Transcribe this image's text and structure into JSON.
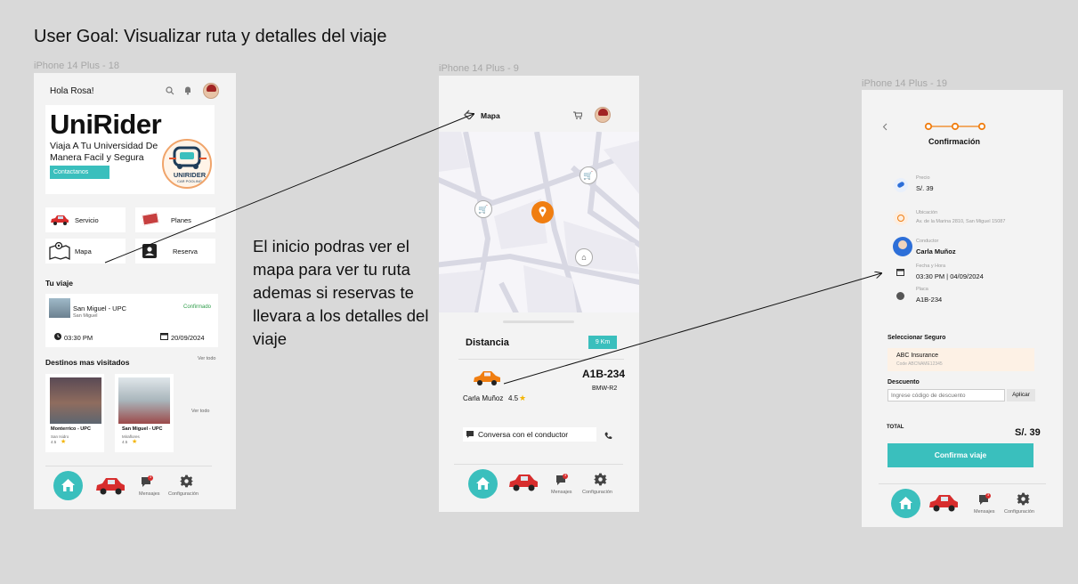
{
  "goal": "User Goal: Visualizar ruta y detalles del viaje",
  "annotation": "El inicio podras ver el mapa para ver tu ruta ademas si reservas te llevara a los detalles del viaje",
  "colors": {
    "accent": "#3abfbd",
    "orange": "#f07e11",
    "red": "#d72d2d",
    "canvas": "#d9d9d9"
  },
  "frame1": {
    "label": "iPhone 14 Plus - 18",
    "greeting": "Hola Rosa!",
    "brand": "UniRider",
    "tagline": "Viaja A Tu Universidad De Manera Facil y Segura",
    "contact_button": "Contactanos",
    "logo_text": "UNIRIDER",
    "logo_sub": "CAR POOLING",
    "tiles": {
      "servicio": "Servicio",
      "planes": "Planes",
      "mapa": "Mapa",
      "reserva": "Reserva"
    },
    "your_trip_title": "Tu viaje",
    "trip": {
      "route": "San Miguel - UPC",
      "district": "San Miguel",
      "status": "Confirmado",
      "time": "03:30 PM",
      "date": "20/09/2024"
    },
    "popular_title": "Destinos mas visitados",
    "see_all": "Ver todo",
    "see_all_2": "Ver todo",
    "destinations": [
      {
        "name": "Monterrico - UPC",
        "area": "San Isidro",
        "rating": "4.5"
      },
      {
        "name": "San Miguel - UPC",
        "area": "Miraflores",
        "rating": "4.5"
      }
    ],
    "nav": {
      "messages": "Mensajes",
      "settings": "Configuración",
      "badge": "3"
    }
  },
  "frame2": {
    "label": "iPhone 14 Plus - 9",
    "title": "Mapa",
    "distance_label": "Distancia",
    "distance_value": "9 Km",
    "plate": "A1B-234",
    "model": "BMW-R2",
    "driver": "Carla Muñoz",
    "rating": "4.5",
    "chat": "Conversa con el conductor",
    "nav": {
      "messages": "Mensajes",
      "settings": "Configuración",
      "badge": "3"
    }
  },
  "frame3": {
    "label": "iPhone 14 Plus - 19",
    "title": "Confirmación",
    "price_label": "Precio",
    "price": "S/. 39",
    "location_label": "Ubicación",
    "location": "Av. de la Marina 2810, San Miguel 15087",
    "driver_label": "Conductor",
    "driver": "Carla Muñoz",
    "datetime_label": "Fecha y Hora",
    "datetime": "03:30 PM | 04/09/2024",
    "plate_label": "Placa",
    "plate": "A1B-234",
    "insurance_title": "Seleccionar Seguro",
    "insurance_name": "ABC Insurance",
    "insurance_code": "Code ABCNAME12345",
    "discount_title": "Descuento",
    "discount_placeholder": "Ingrese código de descuento",
    "apply": "Aplicar",
    "total_label": "TOTAL",
    "total": "S/. 39",
    "confirm": "Confirma viaje",
    "nav": {
      "messages": "Mensajes",
      "settings": "Configuración",
      "badge": "3"
    }
  }
}
